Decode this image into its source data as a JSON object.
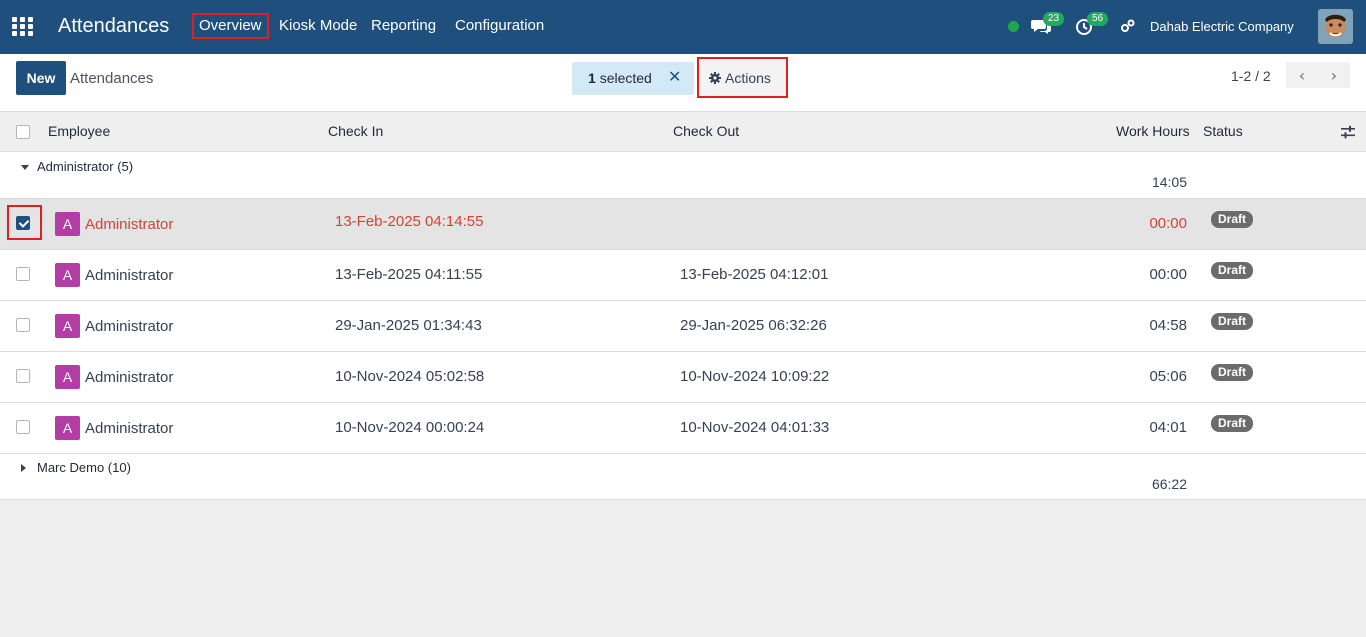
{
  "navbar": {
    "app_title": "Attendances",
    "menu": [
      "Overview",
      "Kiosk Mode",
      "Reporting",
      "Configuration"
    ],
    "messages_count": "23",
    "activities_count": "56",
    "company": "Dahab Electric Company"
  },
  "control_panel": {
    "new_label": "New",
    "breadcrumb": "Attendances",
    "selected_count": "1",
    "selected_label": "selected",
    "clear_label": "✕",
    "actions_label": "Actions",
    "pager": "1-2 / 2"
  },
  "table": {
    "columns": [
      "Employee",
      "Check In",
      "Check Out",
      "Work Hours",
      "Status"
    ],
    "groups": [
      {
        "label": "Administrator (5)",
        "total": "14:05",
        "rows": [
          {
            "avatar": "A",
            "employee": "Administrator",
            "check_in": "13-Feb-2025 04:14:55",
            "check_out": "",
            "work_hours": "00:00",
            "status": "Draft"
          },
          {
            "avatar": "A",
            "employee": "Administrator",
            "check_in": "13-Feb-2025 04:11:55",
            "check_out": "13-Feb-2025 04:12:01",
            "work_hours": "00:00",
            "status": "Draft"
          },
          {
            "avatar": "A",
            "employee": "Administrator",
            "check_in": "29-Jan-2025 01:34:43",
            "check_out": "29-Jan-2025 06:32:26",
            "work_hours": "04:58",
            "status": "Draft"
          },
          {
            "avatar": "A",
            "employee": "Administrator",
            "check_in": "10-Nov-2024 05:02:58",
            "check_out": "10-Nov-2024 10:09:22",
            "work_hours": "05:06",
            "status": "Draft"
          },
          {
            "avatar": "A",
            "employee": "Administrator",
            "check_in": "10-Nov-2024 00:00:24",
            "check_out": "10-Nov-2024 04:01:33",
            "work_hours": "04:01",
            "status": "Draft"
          }
        ]
      },
      {
        "label": "Marc Demo (10)",
        "total": "66:22"
      }
    ]
  },
  "colors": {
    "navbar": "#1f4f7d",
    "primary": "#1f4f7d",
    "avatar": "#b43ca5",
    "danger_row": "#d04437",
    "badge_green": "#23a860",
    "highlight": "#e02020"
  }
}
